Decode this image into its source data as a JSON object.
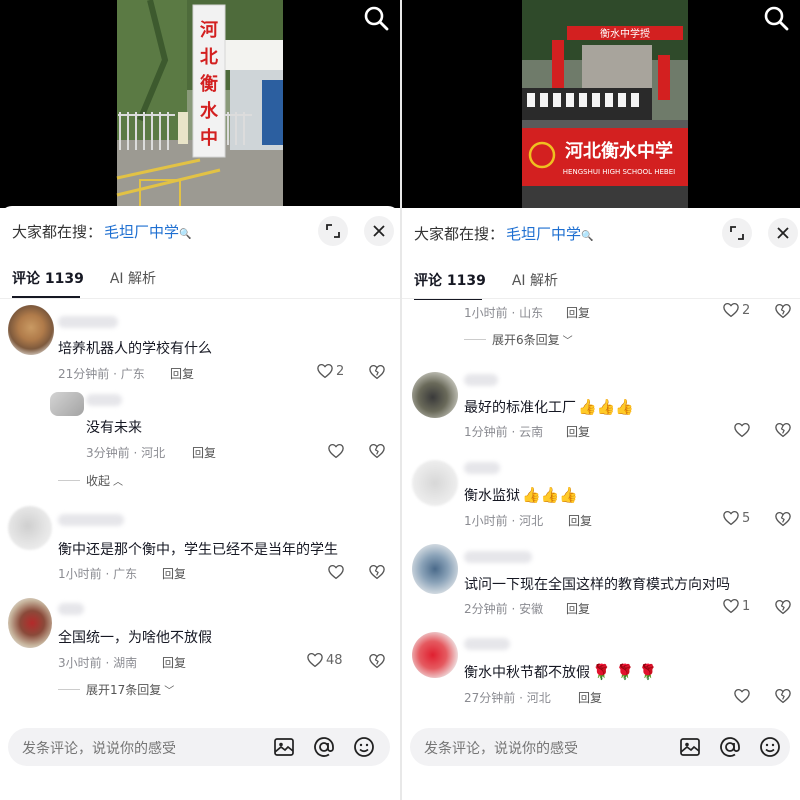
{
  "left": {
    "hot_search": {
      "label": "大家都在搜：",
      "term": "毛坦厂中学",
      "mag": "🔍"
    },
    "tabs": {
      "comments": "评论 1139",
      "ai": "AI 解析"
    },
    "video": {
      "sign_text": "河北衡水中学"
    },
    "comments": [
      {
        "text": "培养机器人的学校有什么",
        "meta": "21分钟前 · 广东",
        "reply": "回复",
        "likes": "2"
      },
      {
        "text": "没有未来",
        "meta": "3分钟前 · 河北",
        "reply": "回复",
        "likes": ""
      },
      {
        "text": "衡中还是那个衡中，学生已经不是当年的学生",
        "meta": "1小时前 · 广东",
        "reply": "回复",
        "likes": ""
      },
      {
        "text": "全国统一，为啥他不放假",
        "meta": "3小时前 · 湖南",
        "reply": "回复",
        "likes": "48"
      }
    ],
    "collapse": "收起",
    "expand": "展开17条回复",
    "input_placeholder": "发条评论，说说你的感受"
  },
  "right": {
    "hot_search": {
      "label": "大家都在搜：",
      "term": "毛坦厂中学",
      "mag": "🔍"
    },
    "tabs": {
      "comments": "评论 1139",
      "ai": "AI 解析"
    },
    "video": {
      "banner_title": "河北衡水中学",
      "banner_sub": "HENGSHUI HIGH SCHOOL HEBEI",
      "top_banner": "衡水中学授"
    },
    "partial": {
      "meta": "1小时前 · 山东",
      "reply": "回复",
      "likes": "2"
    },
    "expand": "展开6条回复",
    "comments": [
      {
        "text": "最好的标准化工厂",
        "emoji": "👍👍👍",
        "meta": "1分钟前 · 云南",
        "reply": "回复",
        "likes": ""
      },
      {
        "text": "衡水监狱",
        "emoji": "👍👍👍",
        "meta": "1小时前 · 河北",
        "reply": "回复",
        "likes": "5"
      },
      {
        "text": "试问一下现在全国这样的教育模式方向对吗",
        "emoji": "",
        "meta": "2分钟前 · 安徽",
        "reply": "回复",
        "likes": "1"
      },
      {
        "text": "衡水中秋节都不放假",
        "emoji": "🌹 🌹 🌹",
        "meta": "27分钟前 · 河北",
        "reply": "回复",
        "likes": ""
      }
    ],
    "input_placeholder": "发条评论，说说你的感受"
  },
  "colors": {
    "link_blue": "#1e6fd1",
    "banner_red": "#d32020",
    "muted": "#8a8b91"
  },
  "icons": [
    "search-icon",
    "fullscreen-icon",
    "close-icon",
    "heart-icon",
    "dislike-icon",
    "image-icon",
    "at-icon",
    "smile-icon",
    "chevron-up-icon",
    "chevron-down-icon"
  ]
}
